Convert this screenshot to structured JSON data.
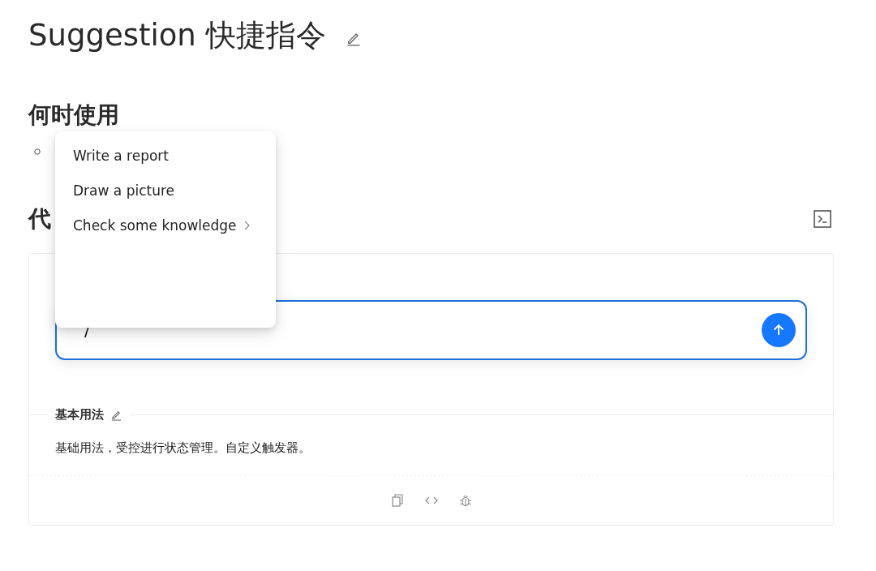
{
  "title": "Suggestion 快捷指令",
  "sections": [
    {
      "heading": "何时使用"
    },
    {
      "heading": "代"
    }
  ],
  "demo": {
    "input": {
      "value": "/",
      "focused": true
    },
    "divider_label": "基本用法",
    "description": "基础用法，受控进行状态管理。自定义触发器。"
  },
  "suggestions": [
    {
      "label": "Write a report",
      "has_submenu": false
    },
    {
      "label": "Draw a picture",
      "has_submenu": false
    },
    {
      "label": "Check some knowledge",
      "has_submenu": true
    }
  ]
}
